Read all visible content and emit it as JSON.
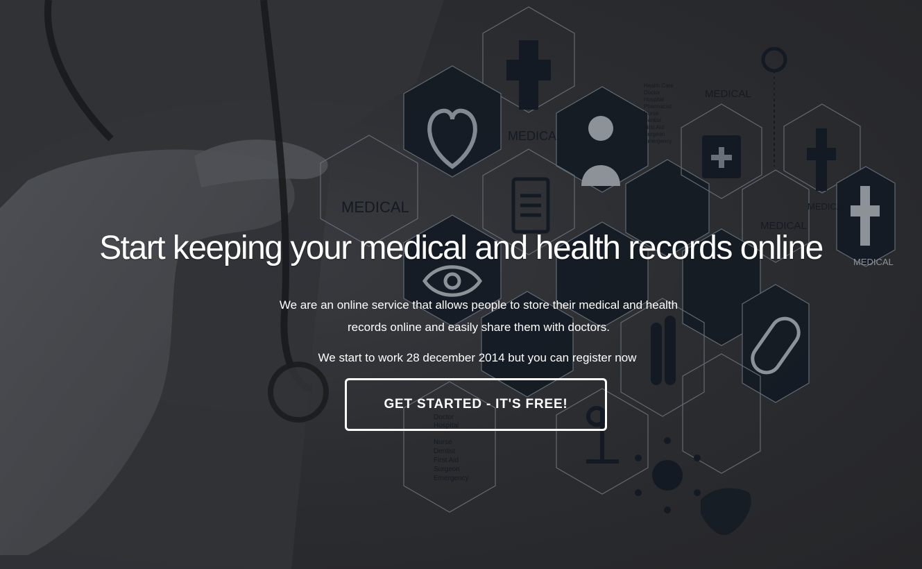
{
  "hero": {
    "headline": "Start keeping your medical and health records online",
    "description": "We are an online service that allows people to store their medical and health records online and easily share them with doctors.",
    "launch_note": "We start to work 28 december 2014 but you can register now",
    "cta_label": "GET STARTED - IT'S FREE!"
  },
  "background_art": {
    "hex_labels": [
      "MEDICAL",
      "MEDICAL",
      "MEDICAL",
      "MEDICAL",
      "MEDICAL",
      "MEDICAL",
      "MEDICAL"
    ],
    "side_list": [
      "Health Care",
      "Doctor",
      "Hospital",
      "Pharmacist",
      "Nurse",
      "Dentist",
      "First Aid",
      "Surgeon",
      "Emergency"
    ],
    "lower_list": [
      "Doctor",
      "Hospital",
      "Nurse",
      "Dentist",
      "First Aid",
      "Surgeon",
      "Emergency"
    ]
  },
  "colors": {
    "background": "#2b2b2d",
    "hex_fill": "#0f1a26",
    "hex_stroke": "#9aa7b5",
    "text": "#ffffff"
  }
}
